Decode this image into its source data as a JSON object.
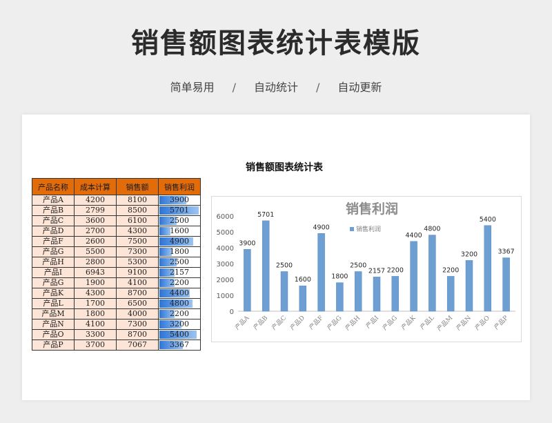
{
  "header": {
    "title": "销售额图表统计表模版",
    "features": [
      "简单易用",
      "自动统计",
      "自动更新"
    ],
    "separator": "/"
  },
  "sheet": {
    "title": "销售额图表统计表",
    "columns": [
      "产品名称",
      "成本计算",
      "销售额",
      "销售利润"
    ],
    "rows": [
      [
        "产品A",
        "4200",
        "8100",
        "3900"
      ],
      [
        "产品B",
        "2799",
        "8500",
        "5701"
      ],
      [
        "产品C",
        "3600",
        "6100",
        "2500"
      ],
      [
        "产品D",
        "2700",
        "4300",
        "1600"
      ],
      [
        "产品F",
        "2600",
        "7500",
        "4900"
      ],
      [
        "产品G",
        "5500",
        "7300",
        "1800"
      ],
      [
        "产品H",
        "2800",
        "5300",
        "2500"
      ],
      [
        "产品I",
        "6943",
        "9100",
        "2157"
      ],
      [
        "产品G",
        "1900",
        "4100",
        "2200"
      ],
      [
        "产品K",
        "4300",
        "8700",
        "4400"
      ],
      [
        "产品L",
        "1700",
        "6500",
        "4800"
      ],
      [
        "产品M",
        "1800",
        "4000",
        "2200"
      ],
      [
        "产品N",
        "4100",
        "7300",
        "3200"
      ],
      [
        "产品O",
        "3300",
        "8700",
        "5400"
      ],
      [
        "产品P",
        "3700",
        "7067",
        "3367"
      ]
    ]
  },
  "chart_data": {
    "type": "bar",
    "title": "销售利润",
    "categories": [
      "产品A",
      "产品B",
      "产品C",
      "产品D",
      "产品F",
      "产品G",
      "产品H",
      "产品I",
      "产品G",
      "产品K",
      "产品L",
      "产品M",
      "产品N",
      "产品O",
      "产品P"
    ],
    "series": [
      {
        "name": "销售利润",
        "values": [
          3900,
          5701,
          2500,
          1600,
          4900,
          1800,
          2500,
          2157,
          2200,
          4400,
          4800,
          2200,
          3200,
          5400,
          3367
        ]
      }
    ],
    "ylim": [
      0,
      6000
    ],
    "yticks": [
      "0",
      "1000",
      "2000",
      "3000",
      "4000",
      "5000",
      "6000"
    ],
    "legend": "top-center",
    "bar_color": "#6e9fd3",
    "grid": false
  },
  "colors": {
    "header_bg": "#e36c0a",
    "row_bg": "#fce4d6",
    "databar": "#2e75d6"
  }
}
